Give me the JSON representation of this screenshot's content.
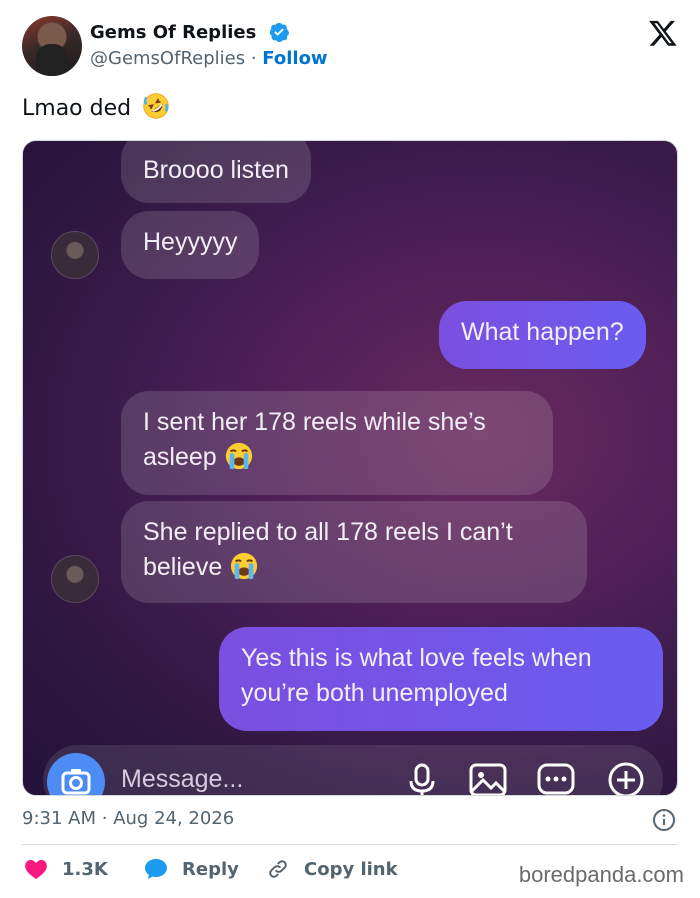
{
  "user": {
    "name": "Gems Of Replies",
    "handle": "@GemsOfReplies",
    "separator": "·",
    "follow_label": "Follow",
    "verified": true
  },
  "tweet": {
    "text": "Lmao ded",
    "emoji": "rolling-on-floor-laughing-emoji"
  },
  "chat": {
    "messages": [
      {
        "side": "in",
        "text": "Broooo listen"
      },
      {
        "side": "in",
        "text": "Heyyyyy"
      },
      {
        "side": "out",
        "text": "What happen?"
      },
      {
        "side": "in",
        "line1": "I sent her 178 reels while she’s",
        "line2": "asleep",
        "emoji": "loudly-crying-emoji"
      },
      {
        "side": "in",
        "line1": "She replied to all 178 reels I can’t",
        "line2": "believe",
        "emoji": "loudly-crying-emoji"
      },
      {
        "side": "out",
        "line1": "Yes this is what love feels when",
        "line2": "you’re both unemployed"
      }
    ],
    "composer_placeholder": "Message..."
  },
  "meta": {
    "time": "9:31 AM",
    "separator": "·",
    "date": "Aug 24, 2026"
  },
  "actions": {
    "likes": "1.3K",
    "reply_label": "Reply",
    "copy_label": "Copy link"
  },
  "watermark": "boredpanda.com",
  "colors": {
    "accent": "#0074d4",
    "heart": "#f91880",
    "reply_icon": "#1d9bf0",
    "outgoing_bubble": "#6a5cf0"
  }
}
